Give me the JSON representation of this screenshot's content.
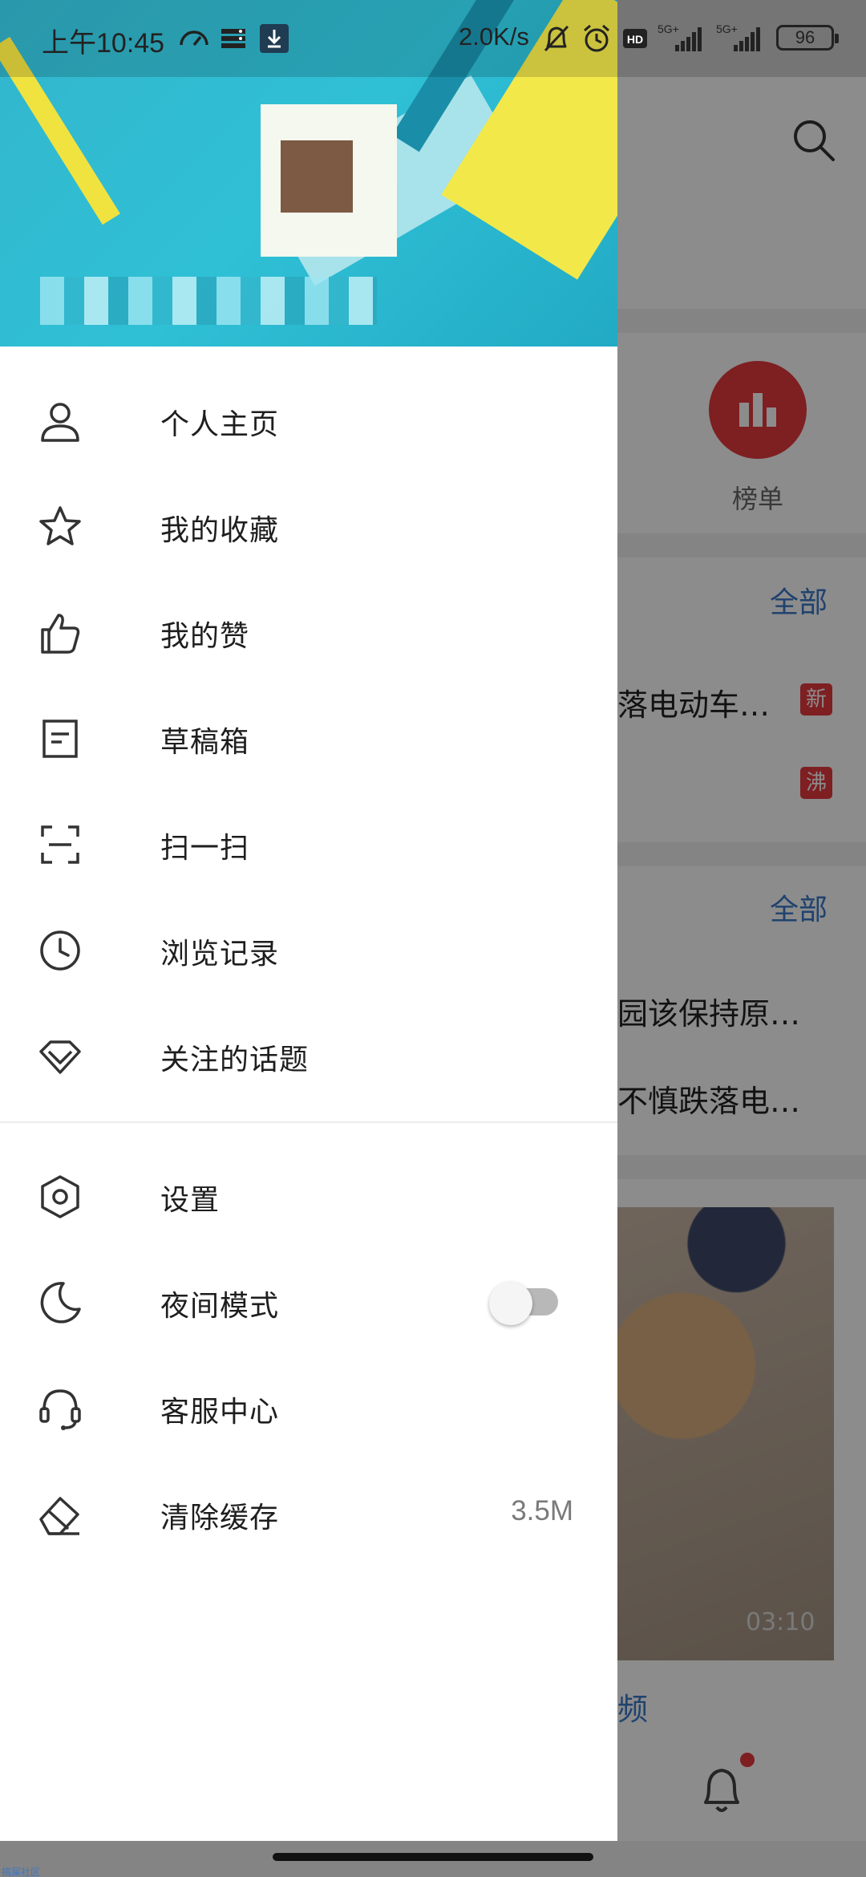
{
  "status_bar": {
    "time": "上午10:45",
    "net_speed": "2.0K/s",
    "signal_1": "5G+",
    "signal_2": "5G+",
    "battery": "96"
  },
  "background": {
    "rank_label": "榜单",
    "more_1": "全部",
    "headline_1": "落电动车…",
    "badge_new": "新",
    "badge_hot": "沸",
    "more_2": "全部",
    "headline_2": "园该保持原…",
    "headline_3": "不慎跌落电…",
    "video_duration": "03:10",
    "video_label": "频"
  },
  "drawer": {
    "menu": [
      {
        "label": "个人主页",
        "icon": "person-icon"
      },
      {
        "label": "我的收藏",
        "icon": "star-icon"
      },
      {
        "label": "我的赞",
        "icon": "thumbs-up-icon"
      },
      {
        "label": "草稿箱",
        "icon": "draft-icon"
      },
      {
        "label": "扫一扫",
        "icon": "scan-icon"
      },
      {
        "label": "浏览记录",
        "icon": "clock-icon"
      },
      {
        "label": "关注的话题",
        "icon": "diamond-icon"
      }
    ],
    "settings": [
      {
        "label": "设置",
        "icon": "gear-icon"
      },
      {
        "label": "夜间模式",
        "icon": "moon-icon",
        "toggle_on": false
      },
      {
        "label": "客服中心",
        "icon": "headset-icon"
      },
      {
        "label": "清除缓存",
        "icon": "eraser-icon",
        "value": "3.5M"
      }
    ]
  },
  "watermark": "搞屎社区"
}
